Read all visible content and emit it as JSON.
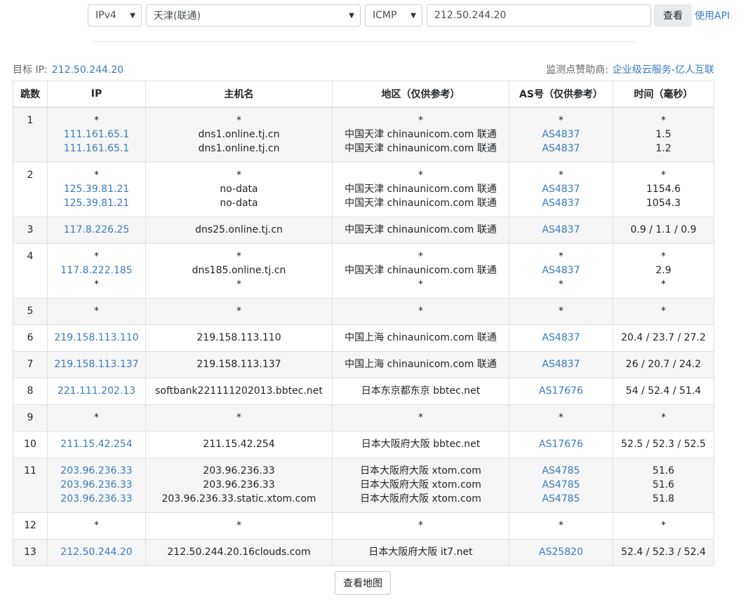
{
  "form": {
    "ipver": "IPv4",
    "node": "天津(联通)",
    "proto": "ICMP",
    "target": "212.50.244.20",
    "query_label": "查看",
    "api_label": "使用API"
  },
  "meta": {
    "target_label": "目标 IP:",
    "target_ip": "212.50.244.20",
    "sponsor_label": "监测点赞助商:",
    "sponsor": "企业级云服务-亿人互联"
  },
  "table": {
    "headers": [
      "跳数",
      "IP",
      "主机名",
      "地区（仅供参考）",
      "AS号（仅供参考）",
      "时间（毫秒）"
    ],
    "rows": [
      {
        "hop": "1",
        "ip": [
          "*",
          "111.161.65.1",
          "111.161.65.1"
        ],
        "host": [
          "*",
          "dns1.online.tj.cn",
          "dns1.online.tj.cn"
        ],
        "region": [
          "*",
          "中国天津 chinaunicom.com 联通",
          "中国天津 chinaunicom.com 联通"
        ],
        "as": [
          "*",
          "AS4837",
          "AS4837"
        ],
        "time": [
          "*",
          "1.5",
          "1.2"
        ]
      },
      {
        "hop": "2",
        "ip": [
          "*",
          "125.39.81.21",
          "125.39.81.21"
        ],
        "host": [
          "*",
          "no-data",
          "no-data"
        ],
        "region": [
          "*",
          "中国天津 chinaunicom.com 联通",
          "中国天津 chinaunicom.com 联通"
        ],
        "as": [
          "*",
          "AS4837",
          "AS4837"
        ],
        "time": [
          "*",
          "1154.6",
          "1054.3"
        ]
      },
      {
        "hop": "3",
        "ip": [
          "117.8.226.25"
        ],
        "host": [
          "dns25.online.tj.cn"
        ],
        "region": [
          "中国天津 chinaunicom.com 联通"
        ],
        "as": [
          "AS4837"
        ],
        "time": [
          "0.9 / 1.1 / 0.9"
        ]
      },
      {
        "hop": "4",
        "ip": [
          "*",
          "117.8.222.185",
          "*"
        ],
        "host": [
          "*",
          "dns185.online.tj.cn",
          "*"
        ],
        "region": [
          "*",
          "中国天津 chinaunicom.com 联通",
          "*"
        ],
        "as": [
          "*",
          "AS4837",
          "*"
        ],
        "time": [
          "*",
          "2.9",
          "*"
        ]
      },
      {
        "hop": "5",
        "ip": [
          "*"
        ],
        "host": [
          "*"
        ],
        "region": [
          "*"
        ],
        "as": [
          "*"
        ],
        "time": [
          "*"
        ]
      },
      {
        "hop": "6",
        "ip": [
          "219.158.113.110"
        ],
        "host": [
          "219.158.113.110"
        ],
        "region": [
          "中国上海 chinaunicom.com 联通"
        ],
        "as": [
          "AS4837"
        ],
        "time": [
          "20.4 / 23.7 / 27.2"
        ]
      },
      {
        "hop": "7",
        "ip": [
          "219.158.113.137"
        ],
        "host": [
          "219.158.113.137"
        ],
        "region": [
          "中国上海 chinaunicom.com 联通"
        ],
        "as": [
          "AS4837"
        ],
        "time": [
          "26 / 20.7 / 24.2"
        ]
      },
      {
        "hop": "8",
        "ip": [
          "221.111.202.13"
        ],
        "host": [
          "softbank221111202013.bbtec.net"
        ],
        "region": [
          "日本东京都东京 bbtec.net"
        ],
        "as": [
          "AS17676"
        ],
        "time": [
          "54 / 52.4 / 51.4"
        ]
      },
      {
        "hop": "9",
        "ip": [
          "*"
        ],
        "host": [
          "*"
        ],
        "region": [
          "*"
        ],
        "as": [
          "*"
        ],
        "time": [
          "*"
        ]
      },
      {
        "hop": "10",
        "ip": [
          "211.15.42.254"
        ],
        "host": [
          "211.15.42.254"
        ],
        "region": [
          "日本大阪府大阪 bbtec.net"
        ],
        "as": [
          "AS17676"
        ],
        "time": [
          "52.5 / 52.3 / 52.5"
        ]
      },
      {
        "hop": "11",
        "ip": [
          "203.96.236.33",
          "203.96.236.33",
          "203.96.236.33"
        ],
        "host": [
          "203.96.236.33",
          "203.96.236.33",
          "203.96.236.33.static.xtom.com"
        ],
        "region": [
          "日本大阪府大阪 xtom.com",
          "日本大阪府大阪 xtom.com",
          "日本大阪府大阪 xtom.com"
        ],
        "as": [
          "AS4785",
          "AS4785",
          "AS4785"
        ],
        "time": [
          "51.6",
          "51.6",
          "51.8"
        ]
      },
      {
        "hop": "12",
        "ip": [
          "*"
        ],
        "host": [
          "*"
        ],
        "region": [
          "*"
        ],
        "as": [
          "*"
        ],
        "time": [
          "*"
        ]
      },
      {
        "hop": "13",
        "ip": [
          "212.50.244.20"
        ],
        "host": [
          "212.50.244.20.16clouds.com"
        ],
        "region": [
          "日本大阪府大阪 it7.net"
        ],
        "as": [
          "AS25820"
        ],
        "time": [
          "52.4 / 52.3 / 52.4"
        ]
      }
    ]
  },
  "map_button": "查看地图",
  "colors": {
    "link": "#3a7bbf",
    "stripe": "#f5f5f5",
    "border": "#dee2e6"
  },
  "icons": {
    "select_caret": "chevron-down-icon"
  }
}
